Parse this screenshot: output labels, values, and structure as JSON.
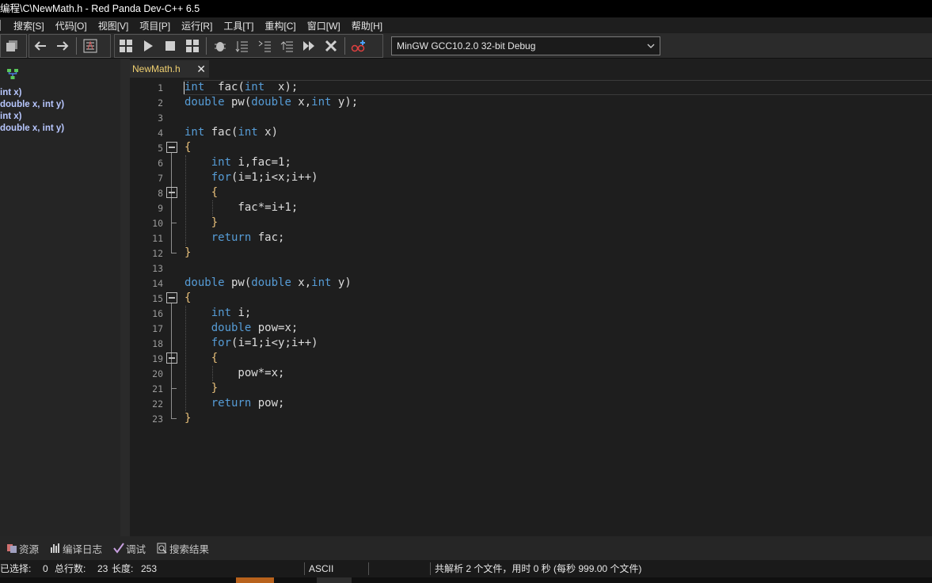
{
  "window": {
    "title": "编程\\C\\NewMath.h - Red Panda Dev-C++ 6.5"
  },
  "menu": [
    "搜索[S]",
    "代码[O]",
    "视图[V]",
    "项目[P]",
    "运行[R]",
    "工具[T]",
    "重构[C]",
    "窗口[W]",
    "帮助[H]"
  ],
  "toolbar": {
    "compiler": "MinGW GCC10.2.0 32-bit Debug"
  },
  "class_browser": [
    "int x)",
    "double x, int y)",
    "int x)",
    "double x, int y)"
  ],
  "editor": {
    "tab": "NewMath.h",
    "lines": [
      [
        [
          "kw",
          "int"
        ],
        [
          "",
          "  fac("
        ],
        [
          "kw",
          "int"
        ],
        [
          "",
          "  x);"
        ]
      ],
      [
        [
          "kw",
          "double"
        ],
        [
          "",
          " pw("
        ],
        [
          "kw",
          "double"
        ],
        [
          "",
          " x,"
        ],
        [
          "kw",
          "int"
        ],
        [
          "",
          " y);"
        ]
      ],
      [],
      [
        [
          "kw",
          "int"
        ],
        [
          "",
          " fac("
        ],
        [
          "kw",
          "int"
        ],
        [
          "",
          " x)"
        ]
      ],
      [
        [
          "br",
          "{"
        ]
      ],
      [
        [
          "",
          "    "
        ],
        [
          "kw",
          "int"
        ],
        [
          "",
          " i,fac=1;"
        ]
      ],
      [
        [
          "",
          "    "
        ],
        [
          "kw",
          "for"
        ],
        [
          "",
          "(i=1;i<x;i++)"
        ]
      ],
      [
        [
          "",
          "    "
        ],
        [
          "br",
          "{"
        ]
      ],
      [
        [
          "",
          "        fac*=i+1;"
        ]
      ],
      [
        [
          "",
          "    "
        ],
        [
          "br",
          "}"
        ]
      ],
      [
        [
          "",
          "    "
        ],
        [
          "kw",
          "return"
        ],
        [
          "",
          " fac;"
        ]
      ],
      [
        [
          "br",
          "}"
        ]
      ],
      [],
      [
        [
          "kw",
          "double"
        ],
        [
          "",
          " pw("
        ],
        [
          "kw",
          "double"
        ],
        [
          "",
          " x,"
        ],
        [
          "kw",
          "int"
        ],
        [
          "",
          " y)"
        ]
      ],
      [
        [
          "br",
          "{"
        ]
      ],
      [
        [
          "",
          "    "
        ],
        [
          "kw",
          "int"
        ],
        [
          "",
          " i;"
        ]
      ],
      [
        [
          "",
          "    "
        ],
        [
          "kw",
          "double"
        ],
        [
          "",
          " pow=x;"
        ]
      ],
      [
        [
          "",
          "    "
        ],
        [
          "kw",
          "for"
        ],
        [
          "",
          "(i=1;i<y;i++)"
        ]
      ],
      [
        [
          "",
          "    "
        ],
        [
          "br",
          "{"
        ]
      ],
      [
        [
          "",
          "        pow*=x;"
        ]
      ],
      [
        [
          "",
          "    "
        ],
        [
          "br",
          "}"
        ]
      ],
      [
        [
          "",
          "    "
        ],
        [
          "kw",
          "return"
        ],
        [
          "",
          " pow;"
        ]
      ],
      [
        [
          "br",
          "}"
        ]
      ]
    ]
  },
  "bottom_tabs": [
    "资源",
    "编译日志",
    "调试",
    "搜索结果"
  ],
  "status": {
    "selected_label": "已选择:",
    "selected": "0",
    "lines_label": "总行数:",
    "lines": "23",
    "length_label": "长度:",
    "length": "253",
    "encoding": "ASCII",
    "parse_msg": "共解析 2 个文件，用时 0 秒 (每秒 999.00 个文件)"
  }
}
